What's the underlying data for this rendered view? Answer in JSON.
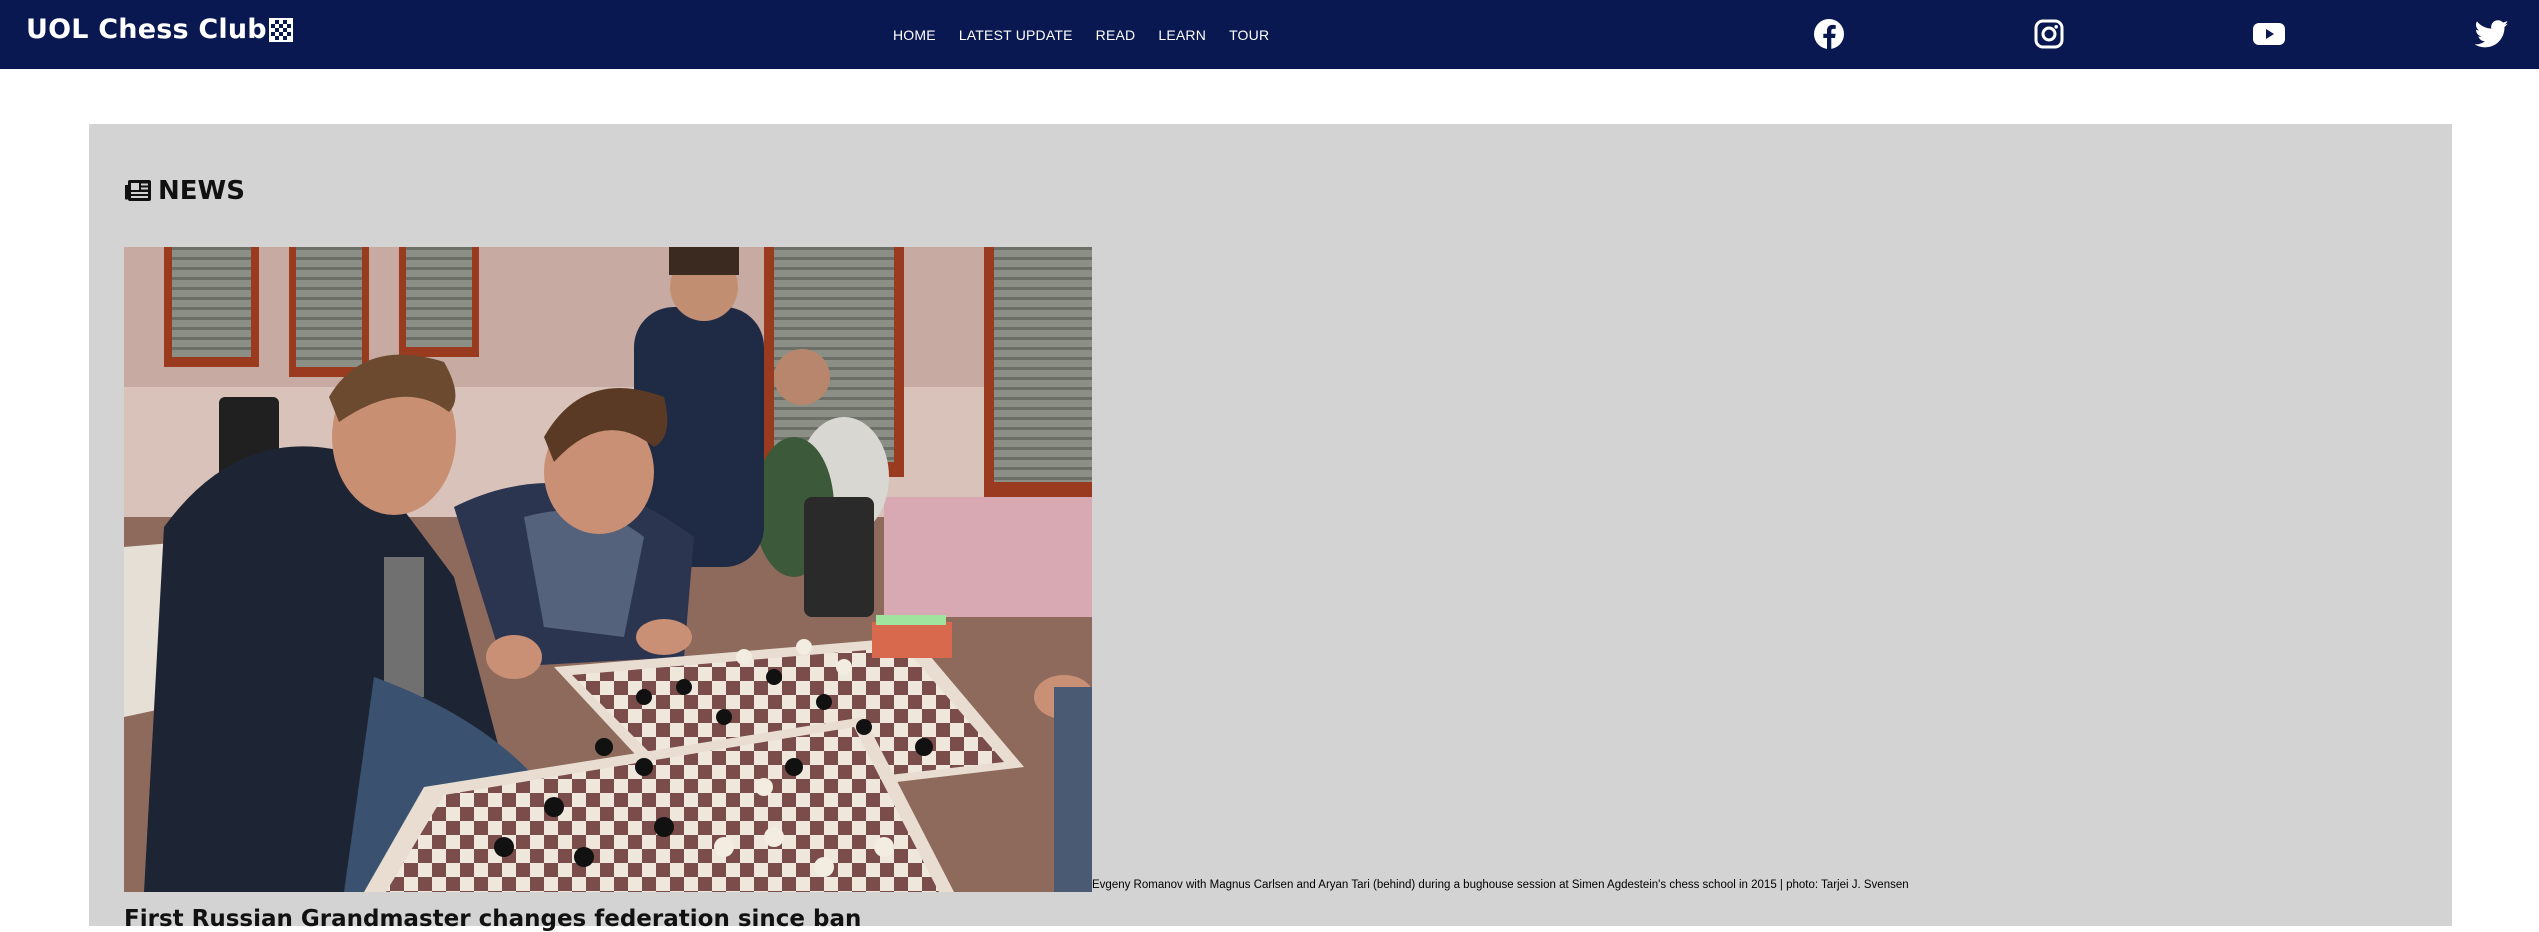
{
  "nav": {
    "brand": "UOL Chess Club",
    "links": [
      "HOME",
      "LATEST UPDATE",
      "READ",
      "LEARN",
      "TOUR"
    ],
    "social_icons": [
      "facebook-icon",
      "instagram-icon",
      "youtube-icon",
      "twitter-icon"
    ]
  },
  "news": {
    "section_title": "NEWS",
    "section_icon": "newspaper-icon",
    "photo_caption": "Evgeny Romanov with Magnus Carlsen and Aryan Tari (behind) during a bughouse session at Simen Agdestein's chess school in 2015 | photo: Tarjei J. Svensen",
    "headline": "First Russian Grandmaster changes federation since ban"
  },
  "colors": {
    "navbar_bg": "#0a1851",
    "content_bg": "#d3d3d3",
    "nav_text": "#ffffff"
  }
}
